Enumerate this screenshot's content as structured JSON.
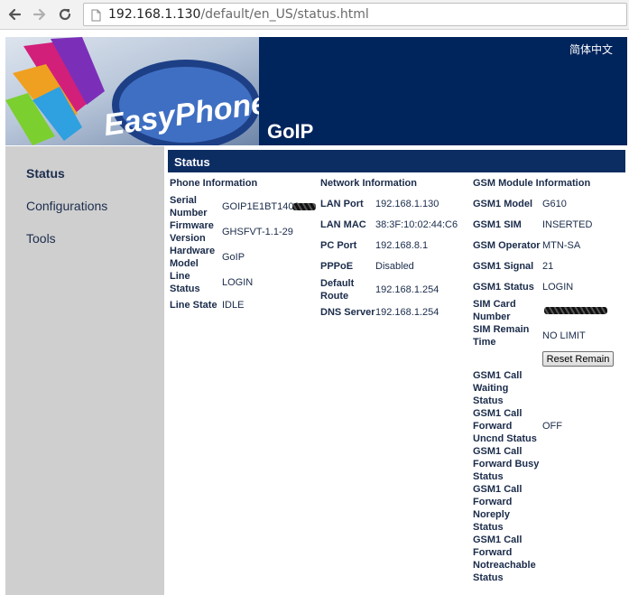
{
  "browser": {
    "url_host": "192.168.1.130",
    "url_path": "/default/en_US/status.html"
  },
  "header": {
    "logo_text": "EasyPhone",
    "language_link": "简体中文",
    "product_title": "GoIP"
  },
  "sidebar": {
    "items": [
      {
        "label": "Status"
      },
      {
        "label": "Configurations"
      },
      {
        "label": "Tools"
      }
    ]
  },
  "status_bar": {
    "title": "Status"
  },
  "phone": {
    "title": "Phone Information",
    "serial_label": "Serial Number",
    "serial_value": "GOIP1E1BT1406",
    "firmware_label": "Firmware Version",
    "firmware_value": "GHSFVT-1.1-29",
    "hardware_label": "Hardware Model",
    "hardware_value": "GoIP",
    "line_status_label": "Line Status",
    "line_status_value": "LOGIN",
    "line_state_label": "Line State",
    "line_state_value": "IDLE"
  },
  "network": {
    "title": "Network Information",
    "lan_port_label": "LAN Port",
    "lan_port_value": "192.168.1.130",
    "lan_mac_label": "LAN MAC",
    "lan_mac_value": "38:3F:10:02:44:C6",
    "pc_port_label": "PC Port",
    "pc_port_value": "192.168.8.1",
    "pppoe_label": "PPPoE",
    "pppoe_value": "Disabled",
    "route_label": "Default Route",
    "route_value": "192.168.1.254",
    "dns_label": "DNS Server",
    "dns_value": "192.168.1.254"
  },
  "gsm": {
    "title": "GSM Module Information",
    "model_label": "GSM1 Model",
    "model_value": "G610",
    "sim_label": "GSM1 SIM",
    "sim_value": "INSERTED",
    "operator_label": "GSM Operator",
    "operator_value": "MTN-SA",
    "signal_label": "GSM1 Signal",
    "signal_value": "21",
    "status_label": "GSM1 Status",
    "status_value": "LOGIN",
    "simcard_label": "SIM Card Number",
    "remain_label": "SIM Remain Time",
    "remain_value": "NO LIMIT",
    "reset_button": "Reset Remain",
    "waiting_label": "GSM1 Call Waiting Status",
    "uncnd_label": "GSM1 Call Forward Uncnd Status",
    "uncnd_value": "OFF",
    "busy_label": "GSM1 Call Forward Busy Status",
    "noreply_label": "GSM1 Call Forward Noreply Status",
    "notreachable_label": "GSM1 Call Forward Notreachable Status"
  },
  "colors": {
    "header_bg": "#00245c",
    "status_bar_bg": "#0c2d62",
    "sidebar_bg": "#cfcfcf",
    "text": "#1a2b4a"
  }
}
